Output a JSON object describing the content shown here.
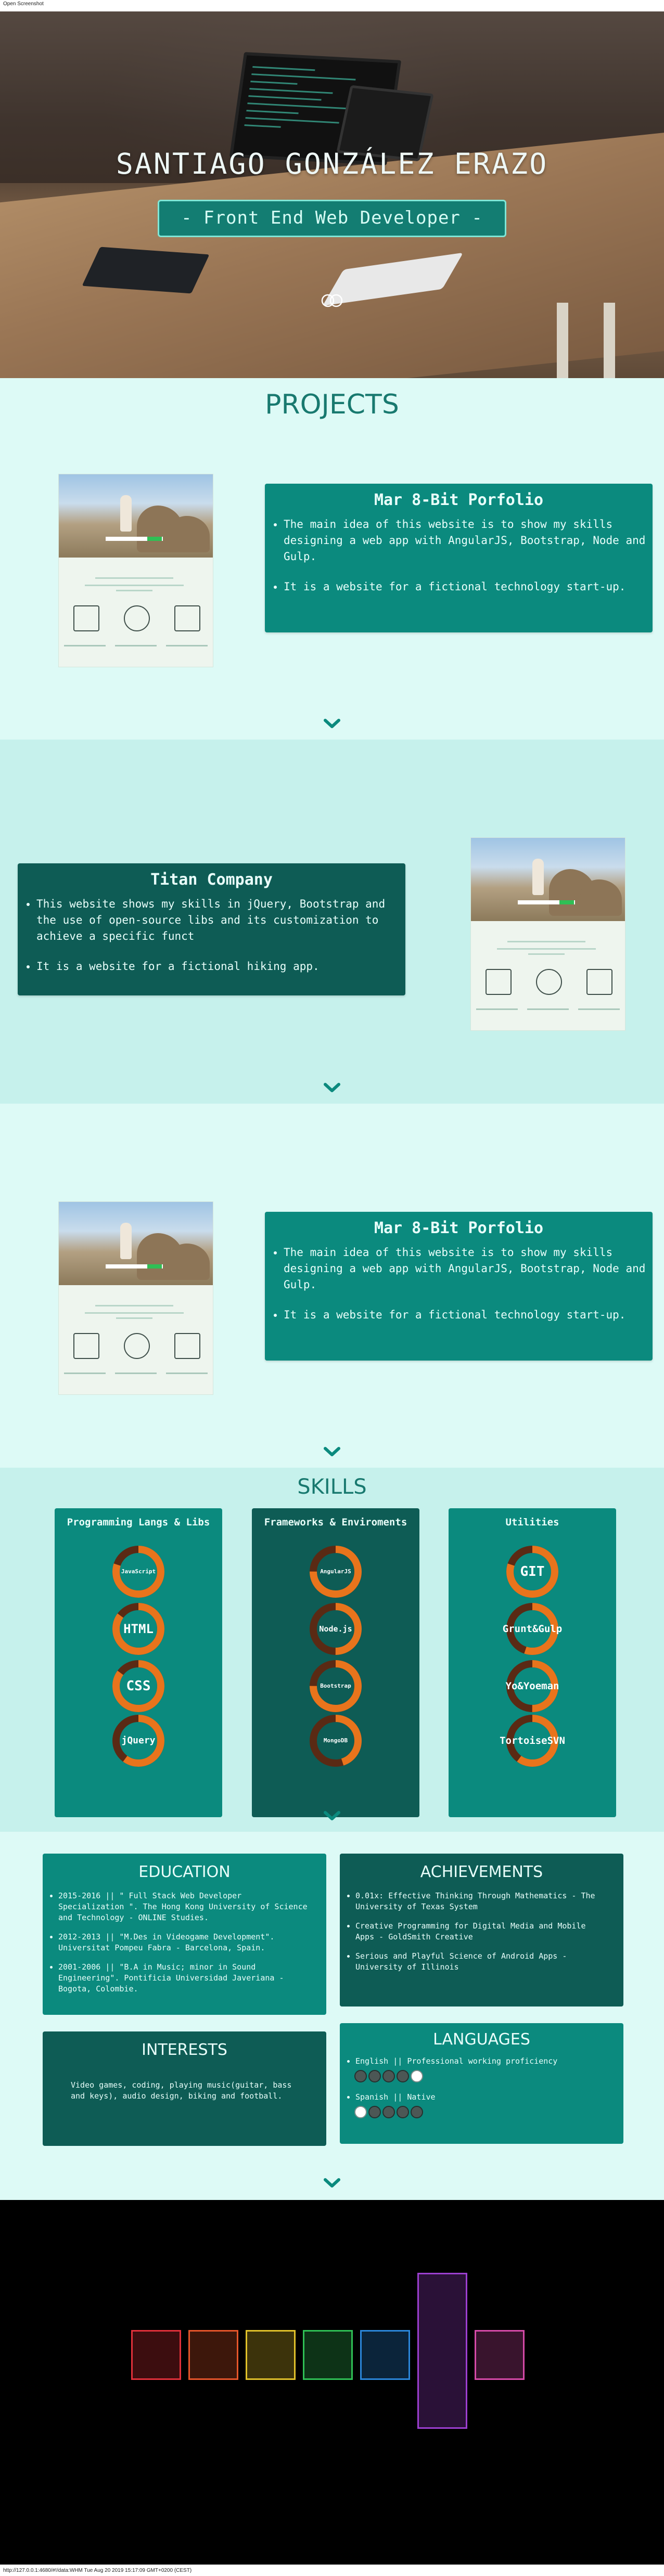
{
  "browser": {
    "header_text": "Open Screenshot",
    "footer_text": "http://127.0.0.1:4680/#!/data:WHM Tue Aug 20 2019 15:17:09 GMT+0200 (CEST)"
  },
  "hero": {
    "name": "SANTIAGO GONZÁLEZ ERAZO",
    "tagline": "- Front End Web Developer -",
    "scroll_icon": "scroll-mouse-icon"
  },
  "projects": {
    "title": "PROJECTS",
    "items": [
      {
        "title": "Mar 8-Bit Porfolio",
        "bullets": [
          "The main idea of this website is to show my skills designing a web app with AngularJS, Bootstrap, Node and Gulp.",
          "It is a website for a fictional technology start-up."
        ]
      },
      {
        "title": "Titan Company",
        "bullets": [
          "This website shows my skills in jQuery, Bootstrap and the use of open-source libs and its customization to achieve a specific funct",
          "It is a website for a fictional hiking app."
        ]
      },
      {
        "title": "Mar 8-Bit Porfolio",
        "bullets": [
          "The main idea of this website is to show my skills designing a web app with AngularJS, Bootstrap, Node and Gulp.",
          "It is a website for a fictional technology start-up."
        ]
      }
    ],
    "chevron_icon": "chevron-down-icon"
  },
  "skills": {
    "title": "SKILLS",
    "columns": [
      {
        "title": "Programming Langs & Libs",
        "items": [
          {
            "label": "JavaScript",
            "level": 0.8
          },
          {
            "label": "HTML",
            "level": 0.85
          },
          {
            "label": "CSS",
            "level": 0.85
          },
          {
            "label": "jQuery",
            "level": 0.6
          }
        ]
      },
      {
        "title": "Frameworks & Enviroments",
        "items": [
          {
            "label": "AngularJS",
            "level": 0.75
          },
          {
            "label": "Node.js",
            "level": 0.5
          },
          {
            "label": "Bootstrap",
            "level": 0.75
          },
          {
            "label": "MongoDB",
            "level": 0.45
          }
        ]
      },
      {
        "title": "Utilities",
        "items": [
          {
            "label": "GIT",
            "level": 0.8
          },
          {
            "label": "Grunt&Gulp",
            "level": 0.55
          },
          {
            "label": "Yo&Yoeman",
            "level": 0.5
          },
          {
            "label": "TortoiseSVN",
            "level": 0.6
          }
        ]
      }
    ],
    "colors": {
      "ring_fill": "#e8741c",
      "ring_track": "#5a2a14"
    }
  },
  "education": {
    "title": "EDUCATION",
    "items": [
      "2015-2016 || \" Full Stack Web Developer Specialization \". The Hong Kong University of Science and Technology - ONLINE Studies.",
      "2012-2013 || \"M.Des in Videogame Development\". Universitat Pompeu Fabra - Barcelona, Spain.",
      "2001-2006 || \"B.A in Music; minor in Sound Engineering\". Pontificia Universidad Javeriana - Bogota, Colombie."
    ]
  },
  "achievements": {
    "title": "ACHIEVEMENTS",
    "items": [
      "0.01x: Effective Thinking Through Mathematics - The University of Texas System",
      "Creative Programming for Digital Media and Mobile Apps - GoldSmith Creative",
      "Serious and Playful Science of Android Apps - University of Illinois"
    ]
  },
  "interests": {
    "title": "INTERESTS",
    "text": "Video games, coding, playing music(guitar, bass and keys), audio design, biking and football."
  },
  "languages": {
    "title": "LANGUAGES",
    "items": [
      {
        "label": "English || Professional working proficiency",
        "level": 4,
        "max": 5
      },
      {
        "label": "Spanish || Native",
        "level": 0,
        "max": 5
      }
    ]
  },
  "game": {
    "blocks": [
      "#e0303a",
      "#e6552a",
      "#e0c12a",
      "#2fbf55",
      "#2b86d9",
      "#9c3fd0",
      "#d64aa8"
    ]
  },
  "colors": {
    "teal": "#0b8a7e",
    "dark_teal": "#0e5c55",
    "light_bg": "#ddfaf6",
    "mid_bg": "#c6f1ec"
  }
}
